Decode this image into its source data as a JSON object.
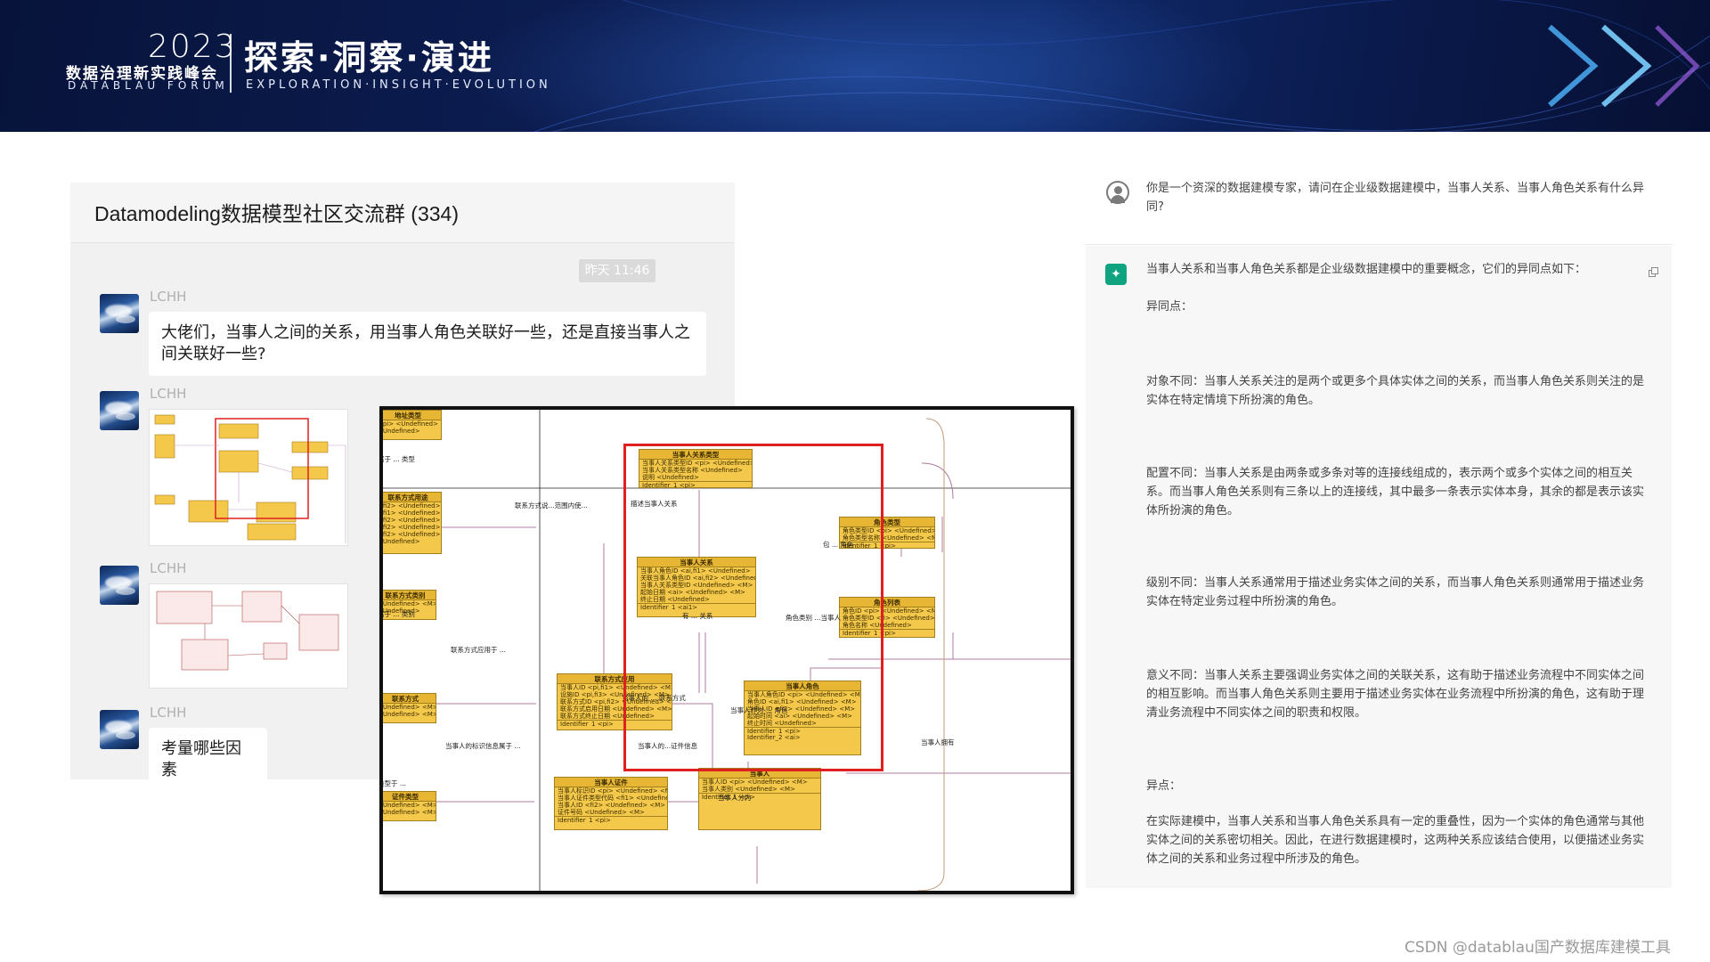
{
  "banner": {
    "year": "2023",
    "forum_cn": "数据治理新实践峰会",
    "forum_en": "DATABLAU FORUM",
    "slogan_cn": "探索·洞察·演进",
    "slogan_en": "EXPLORATION·INSIGHT·EVOLUTION"
  },
  "chat": {
    "title": "Datamodeling数据模型社区交流群 (334)",
    "time": "昨天 11:46",
    "messages": [
      {
        "sender": "LCHH",
        "text": "大佬们，当事人之间的关系，用当事人角色关联好一些，还是直接当事人之间关联好一些?"
      },
      {
        "sender": "LCHH"
      },
      {
        "sender": "LCHH"
      },
      {
        "sender": "LCHH",
        "text": "考量哪些因素"
      }
    ]
  },
  "diagram": {
    "entities": {
      "party_relation_type": {
        "title": "当事人关系类型",
        "rows": [
          "当事人关系类型ID <pi> <Undefined> <M>",
          "当事人关系类型名称 <Undefined>",
          "说明 <Undefined>",
          "Identifier_1 <pi>"
        ]
      },
      "party_relation": {
        "title": "当事人关系",
        "rows": [
          "当事人角色ID <ai,fi1> <Undefined>",
          "关联当事人角色ID <ai,fi2> <Undefined>",
          "当事人关系类型ID <Undefined> <M>",
          "起始日期 <ai> <Undefined> <M>",
          "终止日期 <Undefined>",
          "Identifier_1 <ai1>"
        ]
      },
      "role_type": {
        "title": "角色类型",
        "rows": [
          "角色类型ID <pi> <Undefined> <M>",
          "角色类型名称 <Undefined> <M>",
          "Identifier_1 <pi>"
        ]
      },
      "role_list": {
        "title": "角色列表",
        "rows": [
          "角色ID <pi> <Undefined> <M>",
          "角色类型ID <fi> <Undefined> <M>",
          "角色名称 <Undefined>",
          "Identifier_1 <pi>"
        ]
      },
      "contact_usage": {
        "title": "联系方式应用",
        "rows": [
          "当事人ID <pi,fi1> <Undefined> <M>",
          "设施ID <pi,fi3> <Undefined> <M>",
          "联系方式ID <pi,fi2> <Undefined> <M>",
          "联系方式启用日期 <Undefined> <M>",
          "联系方式终止日期 <Undefined>",
          "Identifier_1 <pi>"
        ]
      },
      "party_role": {
        "title": "当事人角色",
        "rows": [
          "当事人角色ID <pi> <Undefined> <M>",
          "角色ID <ai,fi1> <Undefined> <M>",
          "当事人ID <fi2> <Undefined> <M>",
          "起始时间 <ai> <Undefined> <M>",
          "终止时间 <Undefined>",
          "Identifier_1 <pi>",
          "Identifier_2 <ai>"
        ]
      },
      "party_cert": {
        "title": "当事人证件",
        "rows": [
          "当事人标识ID <pi> <Undefined> <M>",
          "当事人证件类型代码 <fi1> <Undefined> <M>",
          "当事人ID <fi2> <Undefined> <M>",
          "证件号码 <Undefined> <M>",
          "Identifier_1 <pi>"
        ]
      },
      "party": {
        "title": "当事人",
        "rows": [
          "当事人ID <pi> <Undefined> <M>",
          "当事人类别 <Undefined> <M>",
          "Identifier_1 <pi>"
        ]
      },
      "left1": {
        "title": "地址类型",
        "rows": [
          "<pi> <Undefined> <M>",
          "<Undefined>"
        ]
      },
      "left2": {
        "title": "联系方式用途",
        "rows": [
          "<fi2> <Undefined> <M>",
          "<fi1> <Undefined> <M>",
          "<fi2> <Undefined> <M>",
          "<fi2> <Undefined> <M>",
          "<fi2> <Undefined> <M>",
          "<Undefined>"
        ]
      },
      "left3": {
        "title": "联系方式类别",
        "rows": [
          "<Undefined> <M>",
          "<Undefined>"
        ]
      },
      "left4": {
        "title": "联系方式",
        "rows": [
          "<Undefined> <M>",
          "<Undefined> <M>"
        ]
      },
      "left5": {
        "title": "证件类型",
        "rows": [
          "<Undefined> <M>",
          "<Undefined> <M>"
        ]
      }
    },
    "labels": {
      "l1": "描述当事人关系",
      "l2": "联系方式说...范围内使...",
      "l3": "包 ... 角色",
      "l4": "角色类别 ...当事人",
      "l5": "有 ... 关系",
      "l6": "当事人的 ... 联系方式",
      "l7": "当事人作为 ... 角色",
      "l8": "当事人的...证件信息",
      "l9": "当事人分为",
      "l10": "联系方式应用于 ...",
      "l11": "当事人的标识信息属于 ...",
      "l12": "当事人拥有",
      "l13": "属于 ... 类型",
      "l14": "属于 ... 类别",
      "l15": "类型于 ..."
    }
  },
  "ai": {
    "question": "你是一个资深的数据建模专家，请问在企业级数据建模中，当事人关系、当事人角色关系有什么异同?",
    "paragraphs": [
      "当事人关系和当事人角色关系都是企业级数据建模中的重要概念，它们的异同点如下：",
      "异同点：",
      "对象不同：当事人关系关注的是两个或更多个具体实体之间的关系，而当事人角色关系则关注的是实体在特定情境下所扮演的角色。",
      "配置不同：当事人关系是由两条或多条对等的连接线组成的，表示两个或多个实体之间的相互关系。而当事人角色关系则有三条以上的连接线，其中最多一条表示实体本身，其余的都是表示该实体所扮演的角色。",
      "级别不同：当事人关系通常用于描述业务实体之间的关系，而当事人角色关系则通常用于描述业务实体在特定业务过程中所扮演的角色。",
      "意义不同：当事人关系主要强调业务实体之间的关联关系，这有助于描述业务流程中不同实体之间的相互影响。而当事人角色关系则主要用于描述业务实体在业务流程中所扮演的角色，这有助于理清业务流程中不同实体之间的职责和权限。",
      "异点：",
      "在实际建模中，当事人关系和当事人角色关系具有一定的重叠性，因为一个实体的角色通常与其他实体之间的关系密切相关。因此，在进行数据建模时，这两种关系应该结合使用，以便描述业务实体之间的关系和业务过程中所涉及的角色。"
    ]
  },
  "watermark": "CSDN @datablau国产数据库建模工具"
}
